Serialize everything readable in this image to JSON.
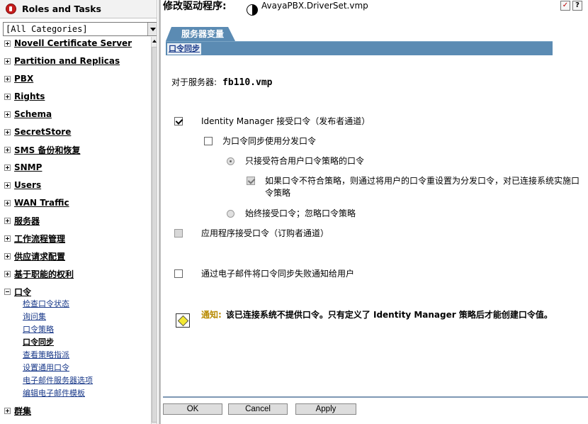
{
  "left_panel": {
    "title": "Roles and Tasks",
    "category_select": {
      "value": "[All Categories]"
    },
    "categories": [
      {
        "label": "Novell Certificate Server",
        "expanded": false
      },
      {
        "label": "Partition and Replicas",
        "expanded": false
      },
      {
        "label": "PBX",
        "expanded": false
      },
      {
        "label": "Rights",
        "expanded": false
      },
      {
        "label": "Schema",
        "expanded": false
      },
      {
        "label": "SecretStore",
        "expanded": false
      },
      {
        "label": "SMS 备份和恢复",
        "expanded": false
      },
      {
        "label": "SNMP",
        "expanded": false
      },
      {
        "label": "Users",
        "expanded": false
      },
      {
        "label": "WAN Traffic",
        "expanded": false
      },
      {
        "label": "服务器",
        "expanded": false
      },
      {
        "label": "工作流程管理",
        "expanded": false
      },
      {
        "label": "供应请求配置",
        "expanded": false
      },
      {
        "label": "基于职能的权利",
        "expanded": false
      },
      {
        "label": "口令",
        "expanded": true
      },
      {
        "label": "群集",
        "expanded": false
      }
    ],
    "password_tasks": [
      "检查口令状态",
      "询问集",
      "口令策略",
      "口令同步",
      "查看策略指派",
      "设置通用口令",
      "电子邮件服务器选项",
      "编辑电子邮件模板"
    ],
    "current_task": "口令同步"
  },
  "header": {
    "title": "修改驱动程序:",
    "driver_name": "AvayaPBX.DriverSet.vmp"
  },
  "tab": {
    "label": "服务器变量",
    "subtab": "口令同步"
  },
  "server": {
    "label": "对于服务器:",
    "name": "fb110.vmp"
  },
  "options": {
    "accept_identity_manager": {
      "label": "Identity Manager 接受口令（发布者通道）",
      "checked": true
    },
    "use_distribution": {
      "label": "为口令同步使用分发口令",
      "checked": false
    },
    "accept_policy_only": {
      "label": "只接受符合用户口令策略的口令",
      "selected": true
    },
    "reset_on_noncompliance": {
      "label": "如果口令不符合策略，则通过将用户的口令重设置为分发口令，对已连接系统实施口令策略",
      "checked": true
    },
    "always_accept": {
      "label": "始终接受口令；忽略口令策略",
      "selected": false
    },
    "app_accept": {
      "label": "应用程序接受口令（订购者通道）",
      "checked": false
    },
    "email_notify": {
      "label": "通过电子邮件将口令同步失败通知给用户",
      "checked": false
    }
  },
  "notice": {
    "label": "通知:",
    "text": "该已连接系统不提供口令。只有定义了 Identity Manager 策略后才能创建口令值。"
  },
  "buttons": {
    "ok": "OK",
    "cancel": "Cancel",
    "apply": "Apply"
  },
  "colors": {
    "tab_blue": "#5b8bb3",
    "link_blue": "#1a3a8a",
    "notice_gold": "#b88a00"
  }
}
